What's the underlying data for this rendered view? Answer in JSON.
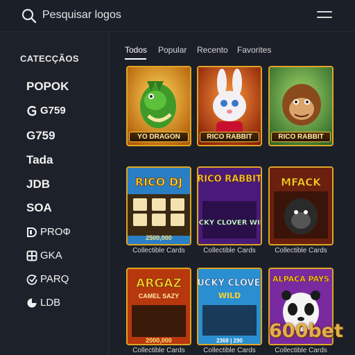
{
  "header": {
    "search_placeholder": "Pesquisar logos",
    "search_icon": "search-icon",
    "menu_icon": "hamburger-menu-icon"
  },
  "sidebar": {
    "title": "CATECÇÃOS",
    "items": [
      {
        "label": "POPOK",
        "icon": null
      },
      {
        "label": "G759",
        "icon": "g-logo-icon"
      },
      {
        "label": "G759",
        "icon": null
      },
      {
        "label": "Tada",
        "icon": null
      },
      {
        "label": "JDB",
        "icon": null
      },
      {
        "label": "SOA",
        "icon": null
      },
      {
        "label": "PROФ",
        "icon": "d-logo-icon"
      },
      {
        "label": "GKA",
        "icon": "grid-logo-icon"
      },
      {
        "label": "PARQ",
        "icon": "check-circle-icon"
      },
      {
        "label": "LDB",
        "icon": "pie-logo-icon"
      }
    ]
  },
  "tabs": [
    {
      "label": "Todos",
      "active": true
    },
    {
      "label": "Popular",
      "active": false
    },
    {
      "label": "Recento",
      "active": false
    },
    {
      "label": "Favorites",
      "active": false
    }
  ],
  "cards_row1": [
    {
      "banner": "YO DRAGON",
      "art": "green dragon"
    },
    {
      "banner": "RICO RABBIT",
      "art": "white rabbit"
    },
    {
      "banner": "RICO RABBIT",
      "art": "monkey"
    }
  ],
  "cards_row2": [
    {
      "title": "RICO DJ",
      "amount": "2500,000",
      "caption": "Collectible Cards"
    },
    {
      "title": "RICO RABBIT",
      "subtitle": "LUCKY CLOVER WILD",
      "caption": "Collectible Cards"
    },
    {
      "title": "MFACK",
      "caption": "Collectible Cards"
    }
  ],
  "cards_row3": [
    {
      "title": "ARGAZ",
      "subtitle": "CAMEL SAZY",
      "amount": "2000,000",
      "caption": "Collectible Cards"
    },
    {
      "title": "LUCKY CLOVER",
      "subtitle": "WILD",
      "amount": "2369 | 290",
      "caption": "Collectible Cards"
    },
    {
      "title": "ALPACA PAYS",
      "caption": "Collectible Cards"
    }
  ],
  "watermark": "600bet",
  "colors": {
    "background": "#1b1f27",
    "sidebar": "#1d2129",
    "card_border": "#e0a625",
    "watermark": "#e0b14a"
  }
}
